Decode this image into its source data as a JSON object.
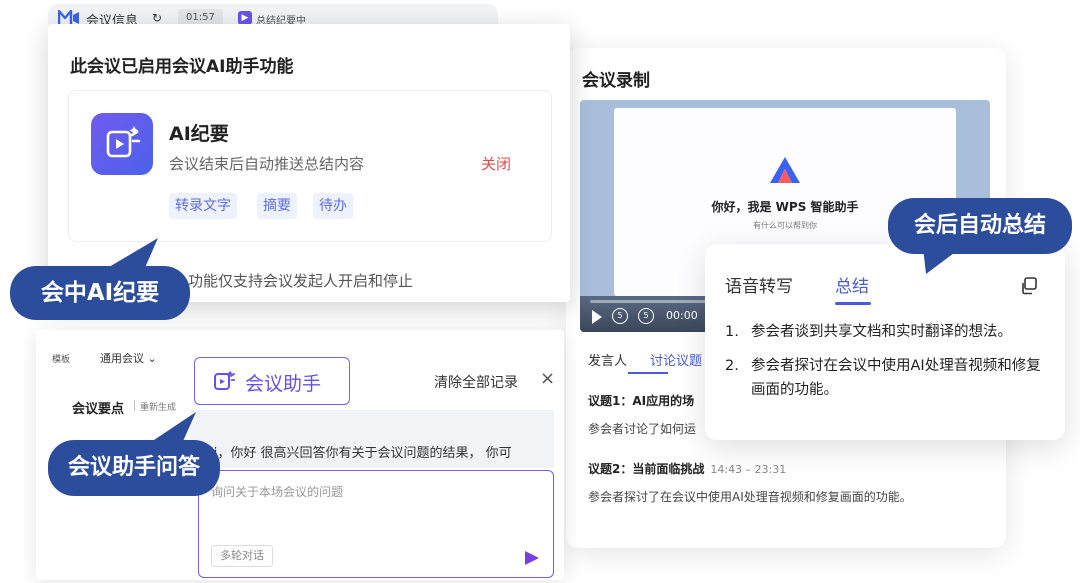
{
  "topbar": {
    "meeting_info": "会议信息",
    "timer": "01:57",
    "recording_status": "总结纪要中"
  },
  "ai_dialog": {
    "title": "此会议已启用会议AI助手功能",
    "feature_title": "AI纪要",
    "feature_desc": "会议结束后自动推送总结内容",
    "close_label": "关闭",
    "chips": [
      "转录文字",
      "摘要",
      "待办"
    ],
    "note": "功能仅支持会议发起人开启和停止"
  },
  "callouts": {
    "in_meeting": "会中AI纪要",
    "post_meeting": "会后自动总结",
    "qa": "会议助手问答"
  },
  "chat": {
    "template_label": "模板",
    "template_value": "通用会议",
    "key_points_title": "会议要点",
    "regenerate": "重新生成",
    "assistant_label": "会议助手",
    "clear_all": "清除全部记录",
    "close_icon": "×",
    "message": "Hi，你好 很高兴回答你有关于会议问题的结果，  你可",
    "input_placeholder": "询问关于本场会议的问题",
    "multi_turn": "多轮对话"
  },
  "recording": {
    "title": "会议录制",
    "video_greeting": "你好，我是 WPS 智能助手",
    "video_subtitle": "有什么可以帮到你",
    "time": "00:00",
    "tabs": [
      "发言人",
      "讨论议题"
    ],
    "active_tab": 1,
    "topics": [
      {
        "title": "议题1：AI应用的场",
        "time": "",
        "desc": "参会者讨论了如何运"
      },
      {
        "title": "议题2：当前面临挑战",
        "time": "14:43 – 23:31",
        "desc": "参会者探讨了在会议中使用AI处理音视频和修复画面的功能。"
      }
    ]
  },
  "summary": {
    "tabs": [
      "语音转写",
      "总结"
    ],
    "active_tab": 1,
    "items": [
      {
        "num": "1.",
        "text": "参会者谈到共享文档和实时翻译的想法。"
      },
      {
        "num": "2.",
        "text": "参会者探讨在会议中使用AI处理音视频和修复画面的功能。"
      }
    ]
  },
  "colors": {
    "accent": "#4b5bd7",
    "purple": "#6a4fe6",
    "callout": "#2c4c9c",
    "danger": "#e34b4b"
  }
}
